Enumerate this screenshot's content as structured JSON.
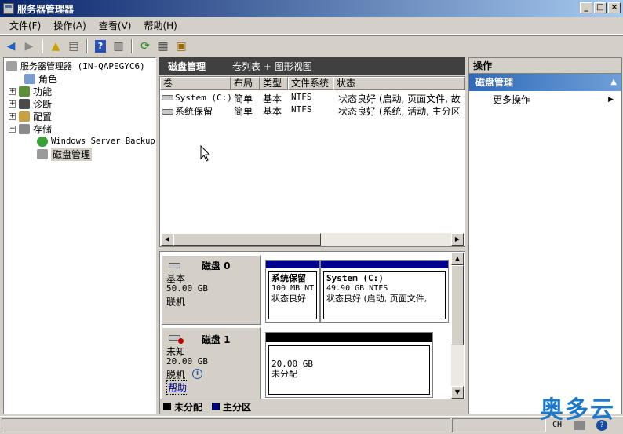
{
  "window": {
    "title": "服务器管理器"
  },
  "menu": [
    "文件(F)",
    "操作(A)",
    "查看(V)",
    "帮助(H)"
  ],
  "tree": {
    "root": "服务器管理器 (IN-QAPEGYC6)",
    "roles": "角色",
    "features": "功能",
    "diagnostics": "诊断",
    "configuration": "配置",
    "storage": "存储",
    "backup": "Windows Server Backup",
    "disk_mgmt": "磁盘管理"
  },
  "center": {
    "title": "磁盘管理",
    "view_mode": "卷列表 + 图形视图"
  },
  "volume_table": {
    "columns": [
      "卷",
      "布局",
      "类型",
      "文件系统",
      "状态"
    ],
    "rows": [
      [
        "System (C:)",
        "简单",
        "基本",
        "NTFS",
        "状态良好 (启动, 页面文件, 故"
      ],
      [
        "系统保留",
        "简单",
        "基本",
        "NTFS",
        "状态良好 (系统, 活动, 主分区"
      ]
    ]
  },
  "disks": [
    {
      "name": "磁盘 0",
      "type": "基本",
      "size": "50.00 GB",
      "state": "联机",
      "partitions": [
        {
          "name": "系统保留",
          "size": "100 MB NT",
          "status": "状态良好"
        },
        {
          "name": "System  (C:)",
          "size": "49.90 GB NTFS",
          "status": "状态良好 (启动, 页面文件,"
        }
      ]
    },
    {
      "name": "磁盘 1",
      "type": "未知",
      "size": "20.00 GB",
      "state": "脱机",
      "help": "帮助",
      "partitions": [
        {
          "size": "20.00 GB",
          "status": "未分配"
        }
      ]
    }
  ],
  "legend": {
    "unallocated": "未分配",
    "primary": "主分区"
  },
  "actions": {
    "header": "操作",
    "group": "磁盘管理",
    "more": "更多操作"
  },
  "watermark": "奥多云",
  "status": {
    "lang": "CH"
  },
  "colors": {
    "primary_partition": "#00008b",
    "unallocated": "#000000",
    "title_start": "#0a246a"
  }
}
